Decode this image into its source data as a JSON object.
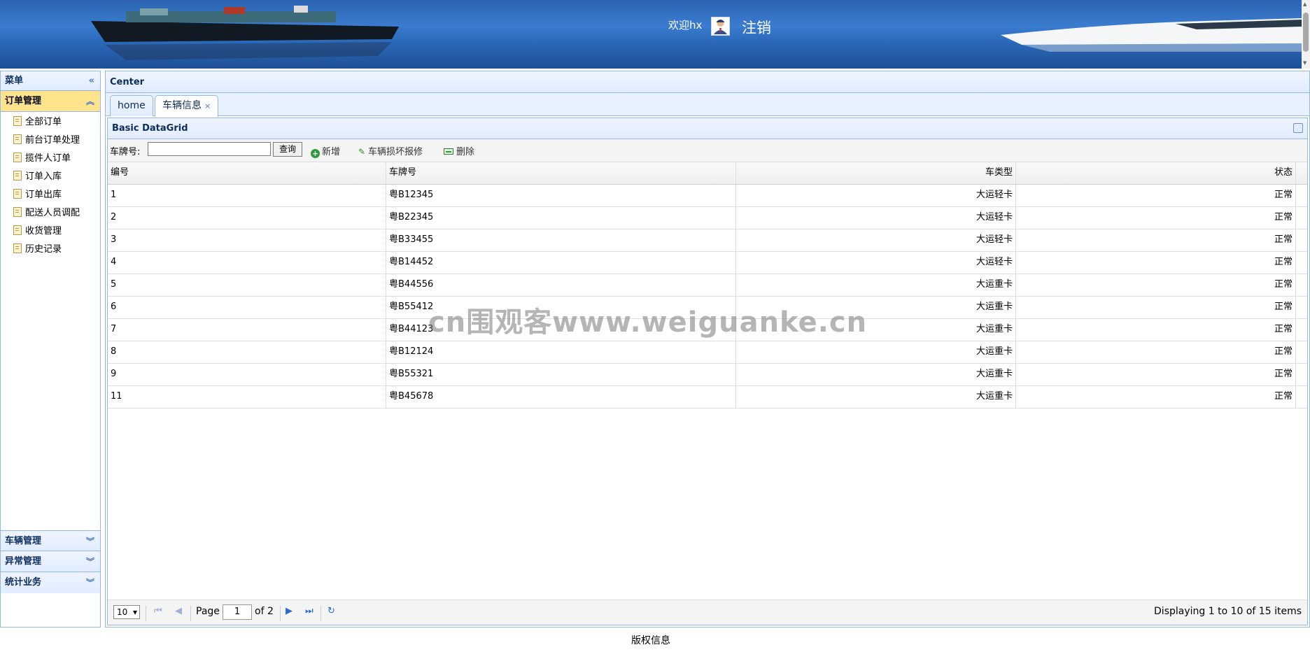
{
  "header": {
    "welcome": "欢迎hx",
    "logout": "注销"
  },
  "west": {
    "title": "菜单",
    "active_group": "订单管理",
    "items": [
      "全部订单",
      "前台订单处理",
      "揽件人订单",
      "订单入库",
      "订单出库",
      "配送人员调配",
      "收货管理",
      "历史记录"
    ],
    "groups": [
      "车辆管理",
      "异常管理",
      "统计业务"
    ]
  },
  "center": {
    "title": "Center",
    "tabs": [
      {
        "label": "home"
      },
      {
        "label": "车辆信息"
      }
    ],
    "grid": {
      "title": "Basic DataGrid",
      "toolbar": {
        "plate_label": "车牌号:",
        "plate_value": "",
        "query": "查询",
        "add": "新增",
        "repair": "车辆损坏报修",
        "delete": "删除"
      },
      "columns": [
        "编号",
        "车牌号",
        "车类型",
        "状态"
      ],
      "rows": [
        [
          "1",
          "粤B12345",
          "大运轻卡",
          "正常"
        ],
        [
          "2",
          "粤B22345",
          "大运轻卡",
          "正常"
        ],
        [
          "3",
          "粤B33455",
          "大运轻卡",
          "正常"
        ],
        [
          "4",
          "粤B14452",
          "大运轻卡",
          "正常"
        ],
        [
          "5",
          "粤B44556",
          "大运重卡",
          "正常"
        ],
        [
          "6",
          "粤B55412",
          "大运重卡",
          "正常"
        ],
        [
          "7",
          "粤B44123",
          "大运重卡",
          "正常"
        ],
        [
          "8",
          "粤B12124",
          "大运重卡",
          "正常"
        ],
        [
          "9",
          "粤B55321",
          "大运重卡",
          "正常"
        ],
        [
          "11",
          "粤B45678",
          "大运重卡",
          "正常"
        ]
      ],
      "pager": {
        "page_size": "10",
        "page_label": "Page",
        "page": "1",
        "of_label": "of 2",
        "display": "Displaying 1 to 10 of 15 items"
      }
    }
  },
  "footer": "版权信息",
  "watermark": "cn围观客www.weiguanke.cn"
}
